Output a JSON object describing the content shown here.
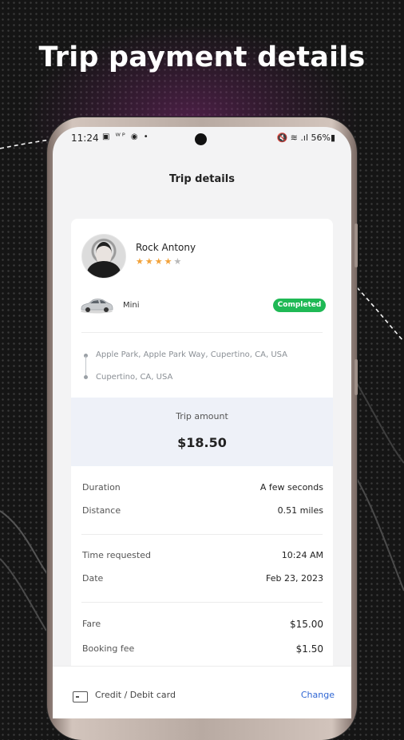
{
  "headline": "Trip payment details",
  "status_bar": {
    "time": "11:24",
    "left_icons": "▣ ᵂᴾ ◉ •",
    "right": "🔇 ≋ .ıl 56%▮"
  },
  "app_bar": {
    "title": "Trip details"
  },
  "driver": {
    "name": "Rock Antony",
    "rating": 4,
    "max_rating": 5
  },
  "vehicle": {
    "type": "Mini",
    "icon": "car-icon"
  },
  "status_badge": "Completed",
  "route": {
    "pickup": "Apple Park, Apple Park Way, Cupertino, CA, USA",
    "dropoff": "Cupertino, CA, USA"
  },
  "trip_amount": {
    "label": "Trip amount",
    "value": "$18.50"
  },
  "details": [
    {
      "label": "Duration",
      "value": "A few seconds"
    },
    {
      "label": "Distance",
      "value": "0.51 miles"
    },
    {
      "label": "Time requested",
      "value": "10:24 AM"
    },
    {
      "label": "Date",
      "value": "Feb 23, 2023"
    },
    {
      "label": "Fare",
      "value": "$15.00"
    },
    {
      "label": "Booking fee",
      "value": "$1.50"
    }
  ],
  "payment": {
    "method": "Credit / Debit card",
    "change_label": "Change"
  },
  "colors": {
    "accent": "#2f66d3",
    "badge": "#1fb955",
    "star": "#f2a23a"
  }
}
